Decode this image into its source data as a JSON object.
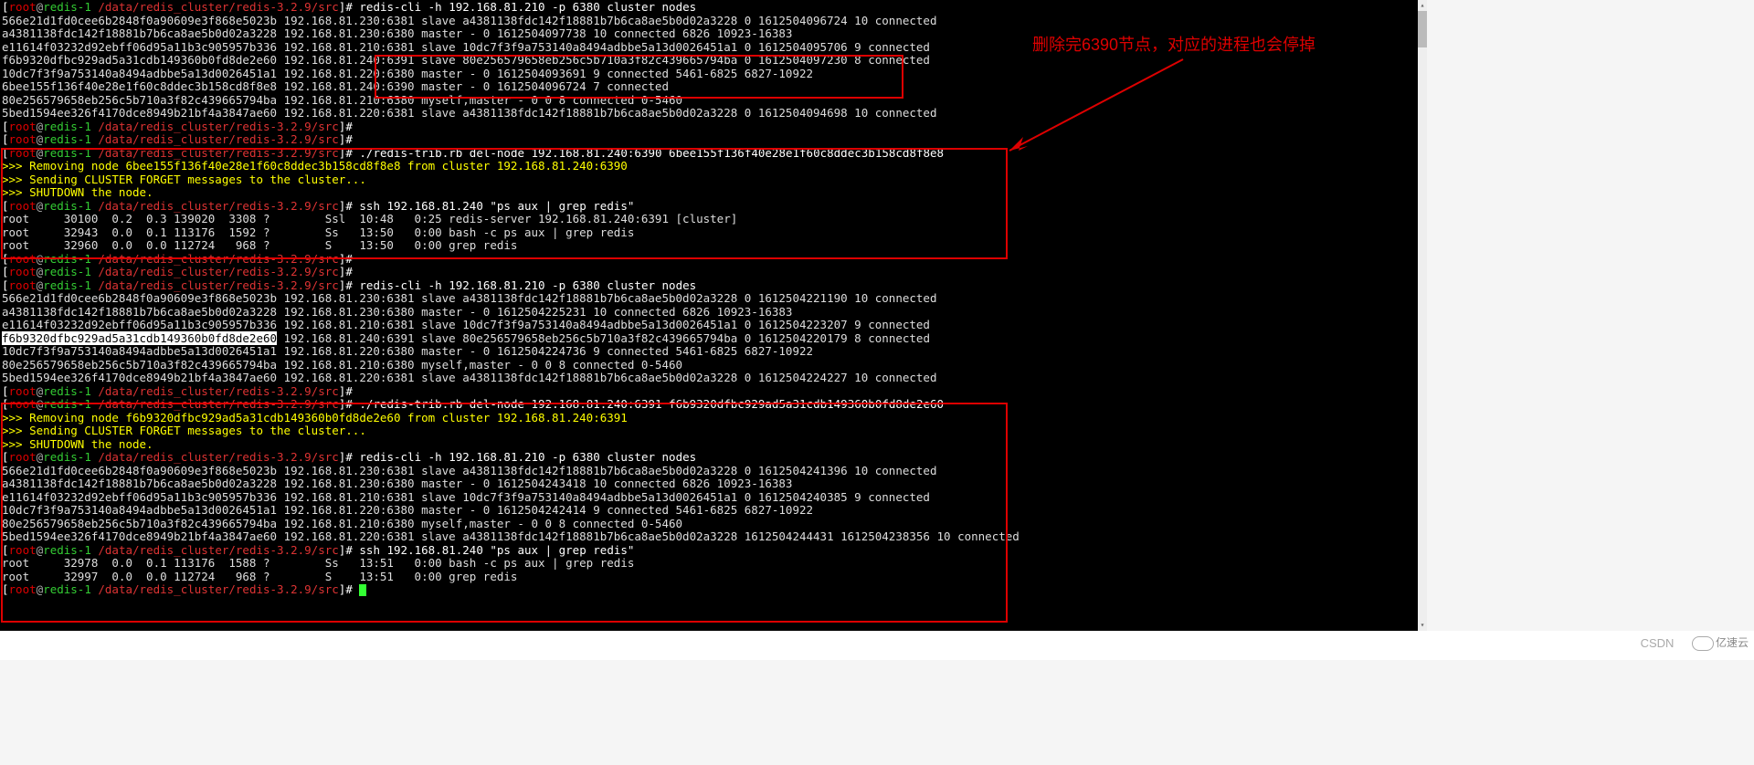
{
  "prompt": {
    "bracket_open": "[",
    "user": "root",
    "at": "@",
    "host": "redis-1",
    "path": " /data/redis_cluster/redis-3.2.9/src",
    "bracket_close": "]",
    "marker": "# "
  },
  "cmds": {
    "c1": "redis-cli -h 192.168.81.210 -p 6380 cluster nodes",
    "c2": "./redis-trib.rb del-node 192.168.81.240:6390 6bee155f136f40e28e1f60c8ddec3b158cd8f8e8",
    "c3": "ssh 192.168.81.240 \"ps aux | grep redis\"",
    "c4": "redis-cli -h 192.168.81.210 -p 6380 cluster nodes",
    "c5": "./redis-trib.rb del-node 192.168.81.240:6391 f6b9320dfbc929ad5a31cdb149360b0fd8de2e60",
    "c6": "redis-cli -h 192.168.81.210 -p 6380 cluster nodes",
    "c7": "ssh 192.168.81.240 \"ps aux | grep redis\""
  },
  "out1": {
    "l1": "566e21d1fd0cee6b2848f0a90609e3f868e5023b 192.168.81.230:6381 slave a4381138fdc142f18881b7b6ca8ae5b0d02a3228 0 1612504096724 10 connected",
    "l2": "a4381138fdc142f18881b7b6ca8ae5b0d02a3228 192.168.81.230:6380 master - 0 1612504097738 10 connected 6826 10923-16383",
    "l3": "e11614f03232d92ebff06d95a11b3c905957b336 192.168.81.210:6381 slave 10dc7f3f9a753140a8494adbbe5a13d0026451a1 0 1612504095706 9 connected",
    "l4a": "f6b9320dfbc929ad5a31cdb149360b0fd8de2e60 192.168.81.240:",
    "l4b": "6391 slave 80e256579658eb256c5b710a3f82c439665794ba 0 1612504097230 8 connected",
    "l5a": "10dc7f3f9a753140a8494adbbe5a13d0026451a1 192.168.81.220:",
    "l5b": "6380 master - 0 1612504093691 9 connected 5461-6825 6827-10922",
    "l6a": "6bee155f136f40e28e1f60c8ddec3b158cd8f8e8 192.168.81.240:",
    "l6b": "6390 master - 0 1612504096724 7 connected",
    "l7": "80e256579658eb256c5b710a3f82c439665794ba 192.168.81.210:6380 myself,master - 0 0 8 connected 0-5460",
    "l8": "5bed1594ee326f4170dce8949b21bf4a3847ae60 192.168.81.220:6381 slave a4381138fdc142f18881b7b6ca8ae5b0d02a3228 0 1612504094698 10 connected"
  },
  "del1": {
    "m1": ">>> Removing node 6bee155f136f40e28e1f60c8ddec3b158cd8f8e8 from cluster 192.168.81.240:6390",
    "m2": ">>> Sending CLUSTER FORGET messages to the cluster...",
    "m3": ">>> SHUTDOWN the node."
  },
  "ps1": {
    "l1": "root     30100  0.2  0.3 139020  3308 ?        Ssl  10:48   0:25 redis-server 192.168.81.240:6391 [cluster]",
    "l2": "root     32943  0.0  0.1 113176  1592 ?        Ss   13:50   0:00 bash -c ps aux | grep redis",
    "l3": "root     32960  0.0  0.0 112724   968 ?        S    13:50   0:00 grep redis"
  },
  "out2": {
    "l1": "566e21d1fd0cee6b2848f0a90609e3f868e5023b 192.168.81.230:6381 slave a4381138fdc142f18881b7b6ca8ae5b0d02a3228 0 1612504221190 10 connected",
    "l2": "a4381138fdc142f18881b7b6ca8ae5b0d02a3228 192.168.81.230:6380 master - 0 1612504225231 10 connected 6826 10923-16383",
    "l3": "e11614f03232d92ebff06d95a11b3c905957b336 192.168.81.210:6381 slave 10dc7f3f9a753140a8494adbbe5a13d0026451a1 0 1612504223207 9 connected",
    "l4a": "f6b9320dfbc929ad5a31cdb149360b0fd8de2e60",
    "l4b": " 192.168.81.240:6391 slave 80e256579658eb256c5b710a3f82c439665794ba 0 1612504220179 8 connected",
    "l5": "10dc7f3f9a753140a8494adbbe5a13d0026451a1 192.168.81.220:6380 master - 0 1612504224736 9 connected 5461-6825 6827-10922",
    "l6": "80e256579658eb256c5b710a3f82c439665794ba 192.168.81.210:6380 myself,master - 0 0 8 connected 0-5460",
    "l7": "5bed1594ee326f4170dce8949b21bf4a3847ae60 192.168.81.220:6381 slave a4381138fdc142f18881b7b6ca8ae5b0d02a3228 0 1612504224227 10 connected"
  },
  "del2": {
    "m1": ">>> Removing node f6b9320dfbc929ad5a31cdb149360b0fd8de2e60 from cluster 192.168.81.240:6391",
    "m2": ">>> Sending CLUSTER FORGET messages to the cluster...",
    "m3": ">>> SHUTDOWN the node."
  },
  "out3": {
    "l1": "566e21d1fd0cee6b2848f0a90609e3f868e5023b 192.168.81.230:6381 slave a4381138fdc142f18881b7b6ca8ae5b0d02a3228 0 1612504241396 10 connected",
    "l2": "a4381138fdc142f18881b7b6ca8ae5b0d02a3228 192.168.81.230:6380 master - 0 1612504243418 10 connected 6826 10923-16383",
    "l3": "e11614f03232d92ebff06d95a11b3c905957b336 192.168.81.210:6381 slave 10dc7f3f9a753140a8494adbbe5a13d0026451a1 0 1612504240385 9 connected",
    "l4": "10dc7f3f9a753140a8494adbbe5a13d0026451a1 192.168.81.220:6380 master - 0 1612504242414 9 connected 5461-6825 6827-10922",
    "l5": "80e256579658eb256c5b710a3f82c439665794ba 192.168.81.210:6380 myself,master - 0 0 8 connected 0-5460",
    "l6": "5bed1594ee326f4170dce8949b21bf4a3847ae60 192.168.81.220:6381 slave a4381138fdc142f18881b7b6ca8ae5b0d02a3228 1612504244431 1612504238356 10 connected"
  },
  "ps2": {
    "l1": "root     32978  0.0  0.1 113176  1588 ?        Ss   13:51   0:00 bash -c ps aux | grep redis",
    "l2": "root     32997  0.0  0.0 112724   968 ?        S    13:51   0:00 grep redis"
  },
  "annotation": "删除完6390节点，对应的进程也会停掉",
  "footer": {
    "csdn": "CSDN",
    "yisu": "亿速云"
  }
}
